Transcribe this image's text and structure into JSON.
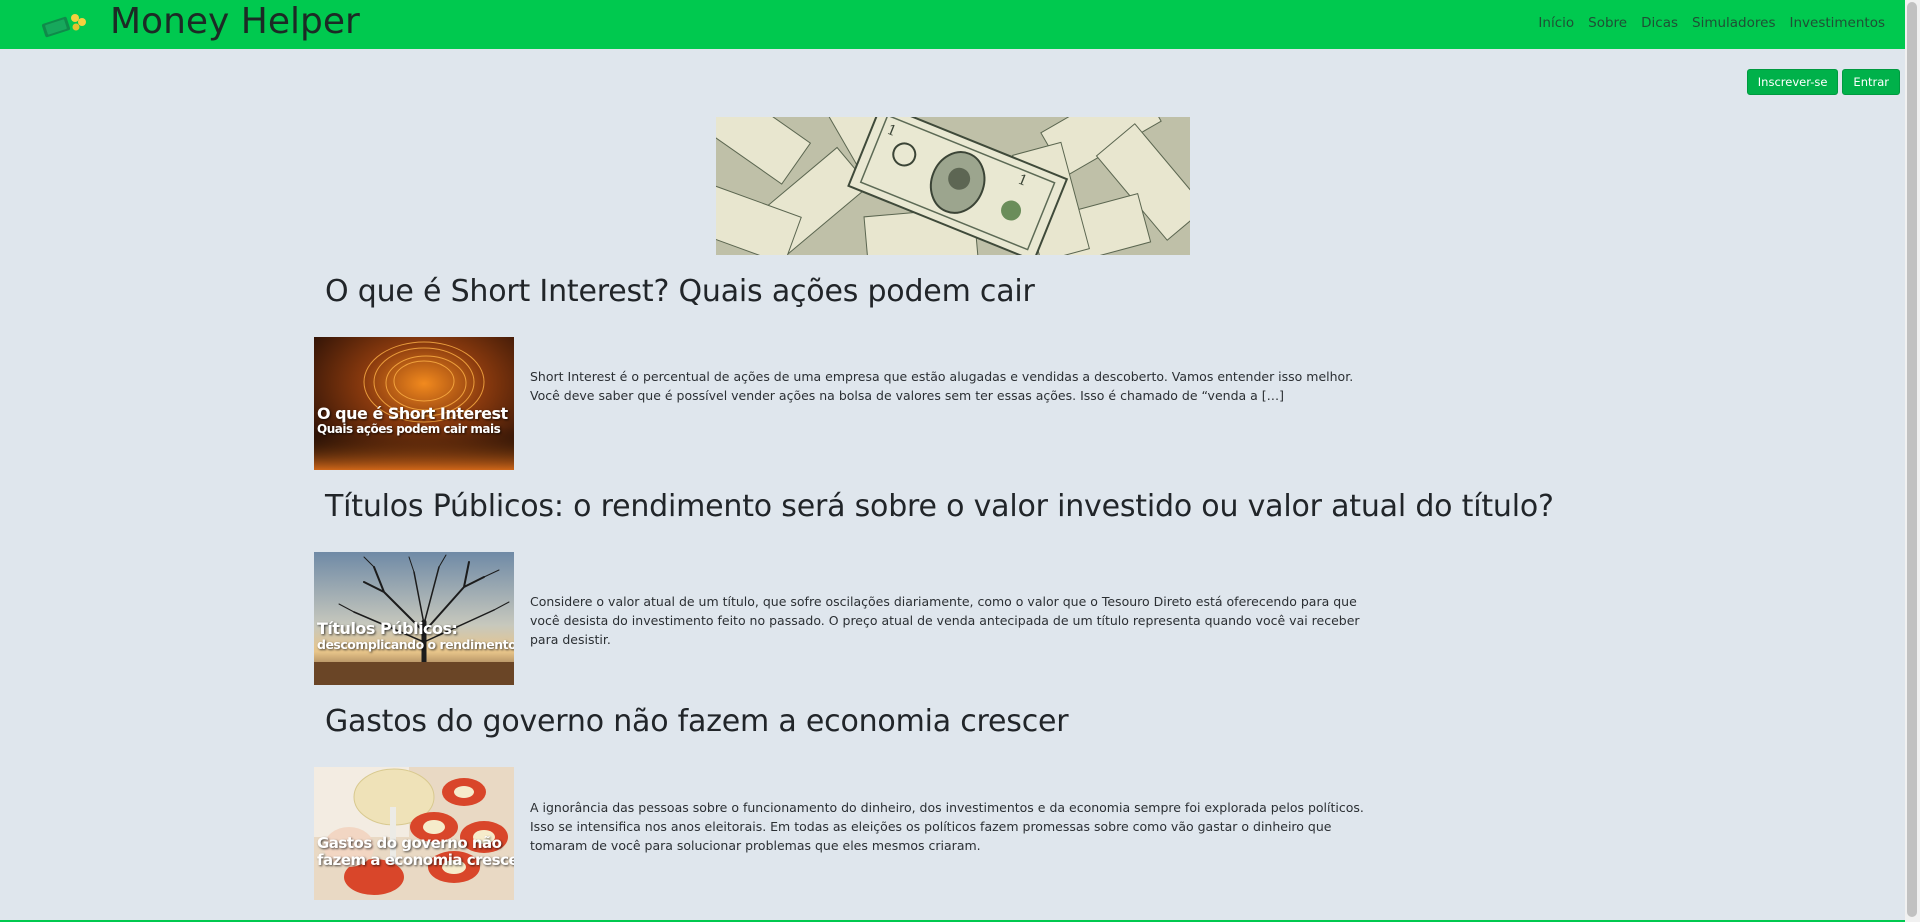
{
  "brand": {
    "title": "Money Helper"
  },
  "nav": [
    "Início",
    "Sobre",
    "Dicas",
    "Simuladores",
    "Investimentos"
  ],
  "auth": {
    "signup": "Inscrever-se",
    "login": "Entrar"
  },
  "posts": [
    {
      "title": "O que é Short Interest? Quais ações podem cair",
      "thumb_line1": "O que é Short Interest",
      "thumb_line2": "Quais ações podem cair mais",
      "excerpt": "Short Interest é o percentual de ações de uma empresa que estão alugadas e vendidas a descoberto. Vamos entender isso melhor. Você deve saber que é possível vender ações na bolsa de valores sem ter essas ações. Isso é chamado de “venda a […]"
    },
    {
      "title": "Títulos Públicos: o rendimento será sobre o valor investido ou valor atual do título?",
      "thumb_line1": "Títulos Públicos:",
      "thumb_line2": "descomplicando o rendimento",
      "excerpt": "Considere o valor atual de um título, que sofre oscilações diariamente, como o valor que o Tesouro Direto está oferecendo para que você desista do investimento feito no passado. O preço atual de venda antecipada de um título representa quando você vai receber para desistir."
    },
    {
      "title": "Gastos do governo não fazem a economia crescer",
      "thumb_line1": "Gastos do governo não",
      "thumb_line2": "fazem a economia crescer",
      "excerpt": "A ignorância das pessoas sobre o funcionamento do dinheiro, dos investimentos e da economia sempre foi explorada pelos políticos. Isso se intensifica nos anos eleitorais. Em todas as eleições os políticos fazem promessas sobre como vão gastar o dinheiro que tomaram de você para solucionar problemas que eles mesmos criaram."
    }
  ]
}
